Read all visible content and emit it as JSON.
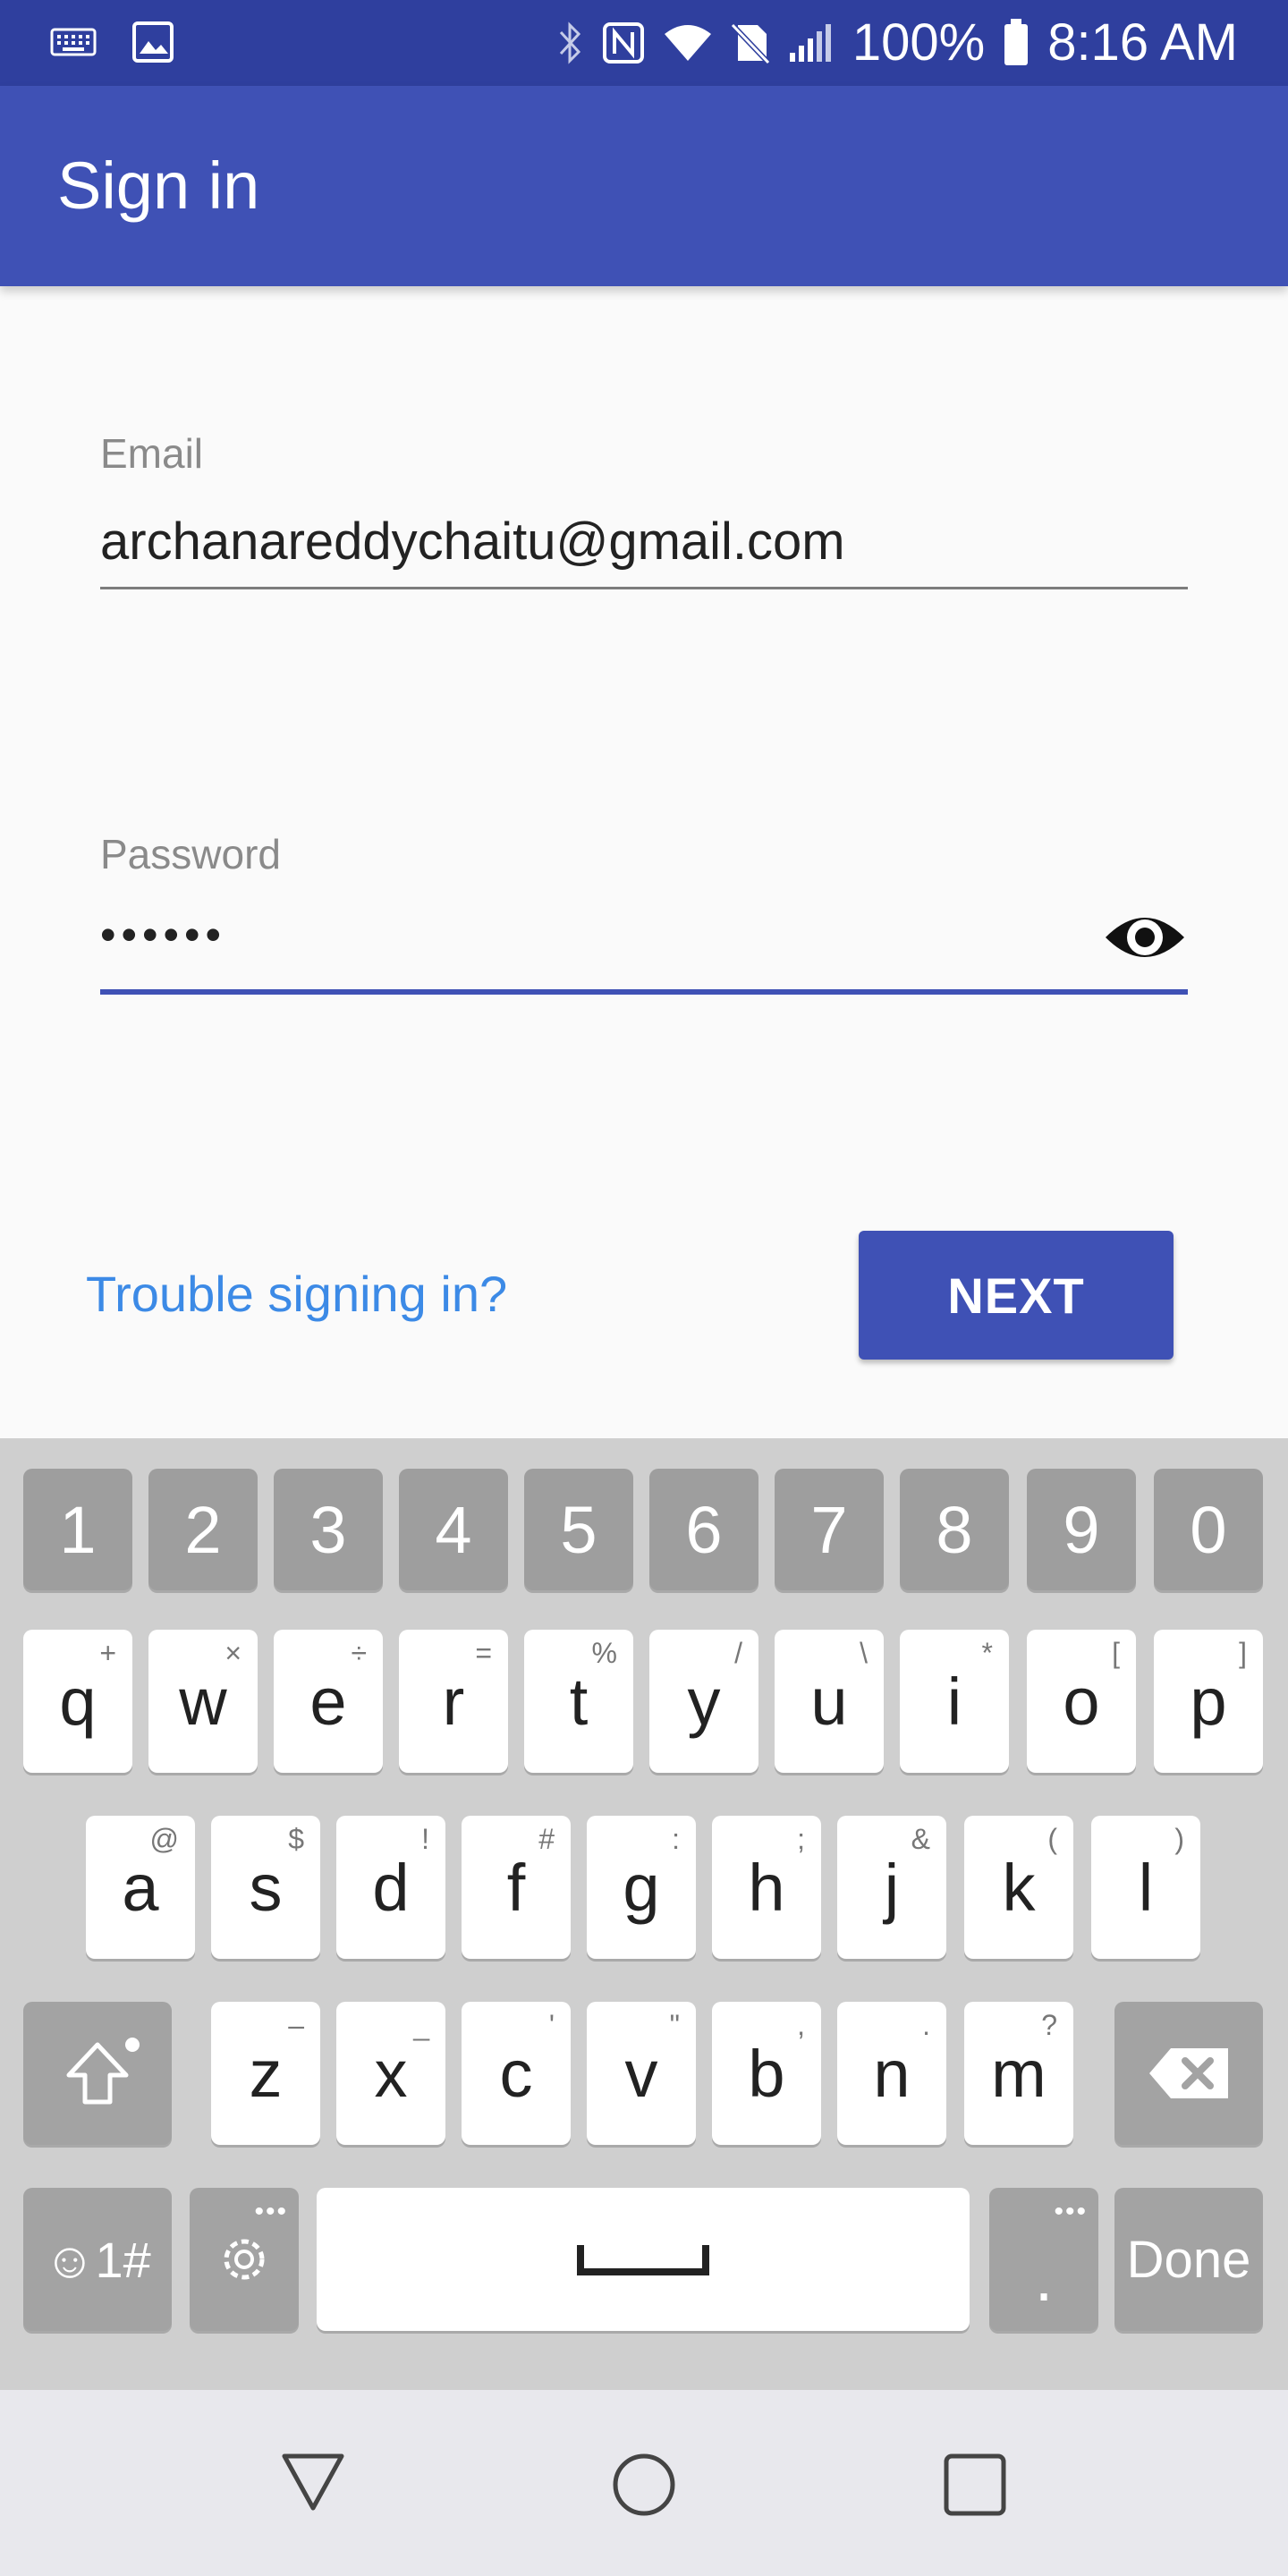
{
  "status_bar": {
    "battery": "100%",
    "time": "8:16 AM",
    "icons": [
      "keyboard-icon",
      "image-icon",
      "bluetooth-icon",
      "nfc-icon",
      "wifi-icon",
      "no-sim-icon",
      "signal-icon",
      "battery-icon"
    ]
  },
  "app_bar": {
    "title": "Sign in",
    "color": "#3f51b5"
  },
  "form": {
    "email_label": "Email",
    "email_value": "archanareddychaitu@gmail.com",
    "password_label": "Password",
    "password_value": "••••••",
    "show_password_icon": "eye-icon"
  },
  "actions": {
    "trouble_link": "Trouble signing in?",
    "next_button": "NEXT"
  },
  "keyboard": {
    "number_row": [
      "1",
      "2",
      "3",
      "4",
      "5",
      "6",
      "7",
      "8",
      "9",
      "0"
    ],
    "row1": [
      {
        "key": "q",
        "alt": "+"
      },
      {
        "key": "w",
        "alt": "×"
      },
      {
        "key": "e",
        "alt": "÷"
      },
      {
        "key": "r",
        "alt": "="
      },
      {
        "key": "t",
        "alt": "%"
      },
      {
        "key": "y",
        "alt": "/"
      },
      {
        "key": "u",
        "alt": "\\"
      },
      {
        "key": "i",
        "alt": "*"
      },
      {
        "key": "o",
        "alt": "["
      },
      {
        "key": "p",
        "alt": "]"
      }
    ],
    "row2": [
      {
        "key": "a",
        "alt": "@"
      },
      {
        "key": "s",
        "alt": "$"
      },
      {
        "key": "d",
        "alt": "!"
      },
      {
        "key": "f",
        "alt": "#"
      },
      {
        "key": "g",
        "alt": ":"
      },
      {
        "key": "h",
        "alt": ";"
      },
      {
        "key": "j",
        "alt": "&"
      },
      {
        "key": "k",
        "alt": "("
      },
      {
        "key": "l",
        "alt": ")"
      }
    ],
    "row3": [
      {
        "key": "z",
        "alt": "–"
      },
      {
        "key": "x",
        "alt": "_"
      },
      {
        "key": "c",
        "alt": "'"
      },
      {
        "key": "v",
        "alt": "\""
      },
      {
        "key": "b",
        "alt": ","
      },
      {
        "key": "n",
        "alt": "."
      },
      {
        "key": "m",
        "alt": "?"
      }
    ],
    "symbols_key": "☺1#",
    "period_key": ".",
    "done_key": "Done"
  },
  "nav_bar": {
    "icons": [
      "back-icon",
      "home-icon",
      "recents-icon"
    ]
  }
}
